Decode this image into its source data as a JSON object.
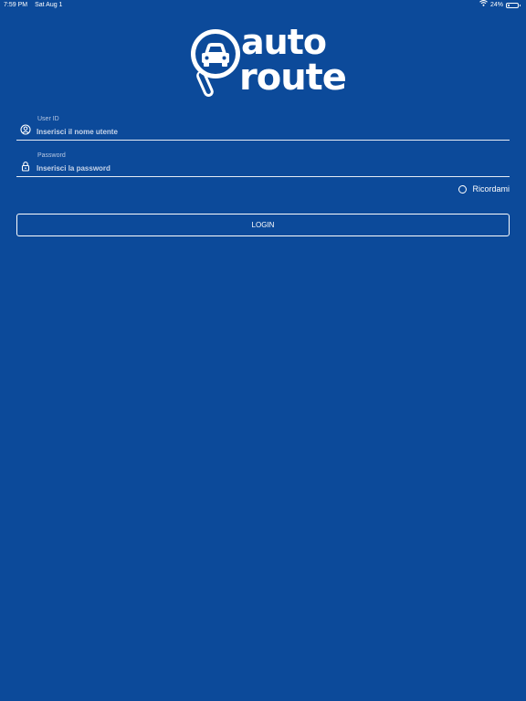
{
  "status_bar": {
    "time": "7:59 PM",
    "date": "Sat Aug 1",
    "battery_text": "24%",
    "battery_level": 0.24
  },
  "logo": {
    "line1": "auto",
    "line2": "route"
  },
  "form": {
    "user_label": "User ID",
    "user_placeholder": "Inserisci il nome utente",
    "password_label": "Password",
    "password_placeholder": "Inserisci la password",
    "remember_label": "Ricordami",
    "remember_checked": false,
    "login_label": "LOGIN"
  },
  "icons": {
    "wifi": "wifi-icon",
    "battery": "battery-icon",
    "user": "user-circle-icon",
    "lock": "lock-icon",
    "car": "car-icon"
  },
  "colors": {
    "background": "#0c4a9a",
    "foreground": "#ffffff"
  }
}
